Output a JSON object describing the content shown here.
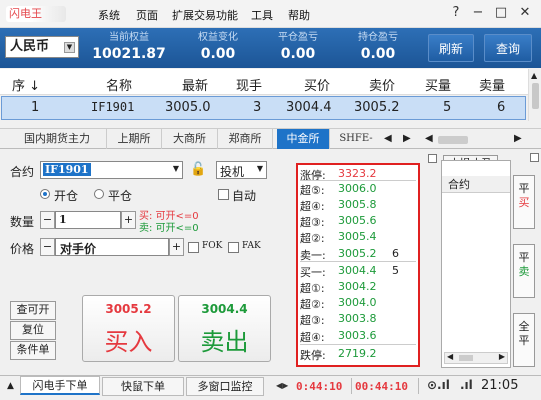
{
  "app": {
    "logo": "闪电王"
  },
  "menu": [
    "系统",
    "页面",
    "扩展交易功能",
    "工具",
    "帮助"
  ],
  "window_controls": [
    "?",
    "−",
    "□",
    "✕"
  ],
  "summary": {
    "currency": "人民币",
    "cols": [
      {
        "label": "当前权益",
        "value": "10021.87"
      },
      {
        "label": "权益变化",
        "value": "0.00"
      },
      {
        "label": "平仓盈亏",
        "value": "0.00"
      },
      {
        "label": "持仓盈亏",
        "value": "0.00"
      }
    ],
    "refresh": "刷新",
    "query": "查询"
  },
  "quote": {
    "headers": [
      "序",
      "名称",
      "最新",
      "现手",
      "买价",
      "卖价",
      "买量",
      "卖量"
    ],
    "row": [
      "1",
      "IF1901",
      "3005.0",
      "3",
      "3004.4",
      "3005.2",
      "5",
      "6"
    ]
  },
  "tabs": [
    "国内期货主力",
    "上期所",
    "大商所",
    "郑商所",
    "中金所",
    "SHFE-"
  ],
  "order": {
    "contract_label": "合约",
    "contract_value": "IF1901",
    "hedge": "投机",
    "open": "开仓",
    "close": "平仓",
    "auto": "自动",
    "qty_label": "数量",
    "qty_value": "1",
    "buy_hint": "买: 可开<=0",
    "sell_hint": "卖: 可开<=0",
    "price_label": "价格",
    "price_value": "对手价",
    "fok": "FOK",
    "fak": "FAK",
    "btn_query": "查可开",
    "btn_reset": "复位",
    "btn_cond": "条件单",
    "buy_price": "3005.2",
    "buy_label": "买入",
    "sell_price": "3004.4",
    "sell_label": "卖出",
    "colors": {
      "buy": "#e5393f",
      "sell": "#1d9a3a"
    }
  },
  "depth": {
    "top": {
      "label": "涨停:",
      "price": "3323.2"
    },
    "sells": [
      {
        "label": "超⑤:",
        "price": "3006.0",
        "vol": ""
      },
      {
        "label": "超④:",
        "price": "3005.8",
        "vol": ""
      },
      {
        "label": "超③:",
        "price": "3005.6",
        "vol": ""
      },
      {
        "label": "超②:",
        "price": "3005.4",
        "vol": ""
      },
      {
        "label": "卖一:",
        "price": "3005.2",
        "vol": "6"
      }
    ],
    "buys": [
      {
        "label": "买一:",
        "price": "3004.4",
        "vol": "5"
      },
      {
        "label": "超①:",
        "price": "3004.2",
        "vol": ""
      },
      {
        "label": "超②:",
        "price": "3004.0",
        "vol": ""
      },
      {
        "label": "超③:",
        "price": "3003.8",
        "vol": ""
      },
      {
        "label": "超④:",
        "price": "3003.6",
        "vol": ""
      }
    ],
    "bottom": {
      "label": "跌停:",
      "price": "2719.2"
    }
  },
  "stop": {
    "title": "止损止盈",
    "col": "合约",
    "btn_buy": [
      "平",
      "买"
    ],
    "btn_sell": [
      "平",
      "卖"
    ],
    "btn_all": [
      "全",
      "平"
    ]
  },
  "status": {
    "tabs": [
      "闪电手下单",
      "快鼠下单",
      "多窗口监控"
    ],
    "time1": "0:44:10",
    "time2": "00:44:10",
    "clock": "21:05"
  }
}
